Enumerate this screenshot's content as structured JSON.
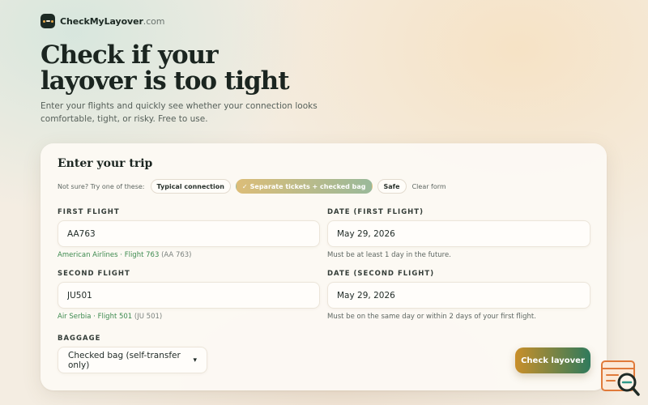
{
  "brand": {
    "name": "CheckMyLayover",
    "tld": ".com",
    "logo_icon": "airplane-logo-icon"
  },
  "hero": {
    "title_line1": "Check if your",
    "title_line2": "layover is too tight",
    "subtitle": "Enter your flights and quickly see whether your connection looks comfortable, tight, or risky. Free to use."
  },
  "form": {
    "title": "Enter your trip",
    "presets": {
      "label": "Not sure? Try one of these:",
      "items": [
        {
          "label": "Typical connection",
          "active": false
        },
        {
          "label": "Separate tickets + checked bag",
          "active": true,
          "icon": "✓"
        },
        {
          "label": "Safe",
          "active": false
        }
      ],
      "clear_label": "Clear form"
    },
    "first_flight": {
      "label": "FIRST FLIGHT",
      "value": "AA763",
      "hint_main": "American Airlines · Flight 763",
      "hint_code": "(AA 763)"
    },
    "first_date": {
      "label": "DATE (FIRST FLIGHT)",
      "value": "May 29, 2026",
      "hint": "Must be at least 1 day in the future."
    },
    "second_flight": {
      "label": "SECOND FLIGHT",
      "value": "JU501",
      "hint_main": "Air Serbia · Flight 501",
      "hint_code": "(JU 501)"
    },
    "second_date": {
      "label": "DATE (SECOND FLIGHT)",
      "value": "May 29, 2026",
      "hint": "Must be on the same day or within 2 days of your first flight."
    },
    "baggage": {
      "label": "BAGGAGE",
      "selected": "Checked bag (self-transfer only)"
    },
    "submit_label": "Check layover"
  },
  "colors": {
    "accent_gold": "#c98f2a",
    "accent_green": "#2f7a5c",
    "hint_green": "#3d8a4f",
    "widget_orange": "#e07a3a"
  }
}
